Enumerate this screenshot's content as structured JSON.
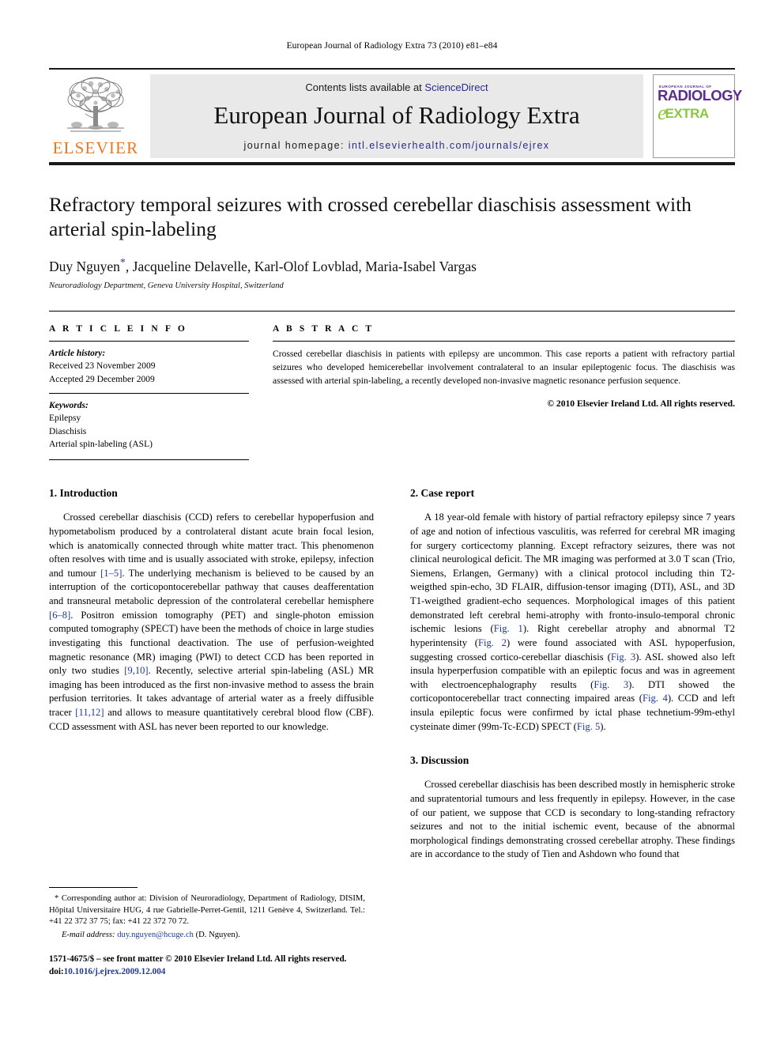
{
  "running_head": "European Journal of Radiology Extra 73 (2010) e81–e84",
  "masthead": {
    "publisher_logo_text": "ELSEVIER",
    "contents_prefix": "Contents lists available at ",
    "contents_link": "ScienceDirect",
    "journal_title": "European Journal of Radiology Extra",
    "homepage_prefix": "journal homepage: ",
    "homepage_url": "intl.elsevierhealth.com/journals/ejrex",
    "badge": {
      "sub": "EUROPEAN JOURNAL OF",
      "main": "RADIOLOGY",
      "e": "e",
      "extra": "EXTRA"
    }
  },
  "article": {
    "title": "Refractory temporal seizures with crossed cerebellar diaschisis assessment with arterial spin-labeling",
    "authors": "Duy Nguyen, Jacqueline Delavelle, Karl-Olof Lovblad, Maria-Isabel Vargas",
    "author_prefix": "Duy Nguyen",
    "author_suffix": ", Jacqueline Delavelle, Karl-Olof Lovblad, Maria-Isabel Vargas",
    "corresponding_marker": "*",
    "affiliation": "Neuroradiology Department, Geneva University Hospital, Switzerland"
  },
  "article_info": {
    "heading": "A R T I C L E   I N F O",
    "history_label": "Article history:",
    "received": "Received 23 November 2009",
    "accepted": "Accepted 29 December 2009",
    "keywords_label": "Keywords:",
    "keywords": [
      "Epilepsy",
      "Diaschisis",
      "Arterial spin-labeling (ASL)"
    ]
  },
  "abstract": {
    "heading": "A B S T R A C T",
    "text": "Crossed cerebellar diaschisis in patients with epilepsy are uncommon. This case reports a patient with refractory partial seizures who developed hemicerebellar involvement contralateral to an insular epileptogenic focus. The diaschisis was assessed with arterial spin-labeling, a recently developed non-invasive magnetic resonance perfusion sequence.",
    "copyright": "© 2010 Elsevier Ireland Ltd. All rights reserved."
  },
  "sections": {
    "introduction": {
      "title": "1.  Introduction",
      "paragraph_parts": [
        "Crossed cerebellar diaschisis (CCD) refers to cerebellar hypoperfusion and hypometabolism produced by a controlateral distant acute brain focal lesion, which is anatomically connected through white matter tract. This phenomenon often resolves with time and is usually associated with stroke, epilepsy, infection and tumour ",
        "[1–5]",
        ". The underlying mechanism is believed to be caused by an interruption of the corticopontocerebellar pathway that causes deafferentation and transneural metabolic depression of the controlateral cerebellar hemisphere ",
        "[6–8]",
        ". Positron emission tomography (PET) and single-photon emission computed tomography (SPECT) have been the methods of choice in large studies investigating this functional deactivation. The use of perfusion-weighted magnetic resonance (MR) imaging (PWI) to detect CCD has been reported in only two studies ",
        "[9,10]",
        ". Recently, selective arterial spin-labeling (ASL) MR imaging has been introduced as the first non-invasive method to assess the brain perfusion territories. It takes advantage of arterial water as a freely diffusible tracer ",
        "[11,12]",
        " and allows to measure quantitatively cerebral blood flow (CBF). CCD assessment with ASL has never been reported to our knowledge."
      ]
    },
    "case_report": {
      "title": "2.  Case report",
      "paragraph_parts": [
        "A 18 year-old female with history of partial refractory epilepsy since 7 years of age and notion of infectious vasculitis, was referred for cerebral MR imaging for surgery corticectomy planning. Except refractory seizures, there was not clinical neurological deficit. The MR imaging was performed at 3.0 T scan (Trio, Siemens, Erlangen, Germany) with a clinical protocol including thin T2-weigthed spin-echo, 3D FLAIR, diffusion-tensor imaging (DTI), ASL, and 3D T1-weigthed gradient-echo sequences. Morphological images of this patient demonstrated left cerebral hemi-atrophy with fronto-insulo-temporal chronic ischemic lesions (",
        "Fig. 1",
        "). Right cerebellar atrophy and abnormal T2 hyperintensity (",
        "Fig. 2",
        ") were found associated with ASL hypoperfusion, suggesting crossed cortico-cerebellar diaschisis (",
        "Fig. 3",
        "). ASL showed also left insula hyperperfusion compatible with an epileptic focus and was in agreement with electroencephalography results (",
        "Fig. 3",
        "). DTI showed the corticopontocerebellar tract connecting impaired areas (",
        "Fig. 4",
        "). CCD and left insula epileptic focus were confirmed by ictal phase technetium-99m-ethyl cysteinate dimer (99m-Tc-ECD) SPECT (",
        "Fig. 5",
        ")."
      ]
    },
    "discussion": {
      "title": "3.  Discussion",
      "paragraph": "Crossed cerebellar diaschisis has been described mostly in hemispheric stroke and supratentorial tumours and less frequently in epilepsy. However, in the case of our patient, we suppose that CCD is secondary to long-standing refractory seizures and not to the initial ischemic event, because of the abnormal morphological findings demonstrating crossed cerebellar atrophy. These findings are in accordance to the study of Tien and Ashdown who found that"
    }
  },
  "footnote": {
    "marker": "*",
    "corresponding": " Corresponding author at: Division of Neuroradiology, Department of Radiology, DISIM, Hôpital Universitaire HUG, 4 rue Gabrielle-Perret-Gentil, 1211 Genève 4, Switzerland. Tel.: +41 22 372 37 75; fax: +41 22 372 70 72.",
    "email_label": "E-mail address:",
    "email": "duy.nguyen@hcuge.ch",
    "email_suffix": " (D. Nguyen)."
  },
  "colophon": {
    "issn_line": "1571-4675/$ – see front matter © 2010 Elsevier Ireland Ltd. All rights reserved.",
    "doi_prefix": "doi:",
    "doi": "10.1016/j.ejrex.2009.12.004"
  },
  "colors": {
    "link_blue": "#2a2a8c",
    "ref_blue": "#1f3a93",
    "elsevier_orange": "#E87722",
    "badge_purple": "#5b2d8e",
    "badge_green": "#8cc63e",
    "banner_gray": "#e9e9e9"
  }
}
